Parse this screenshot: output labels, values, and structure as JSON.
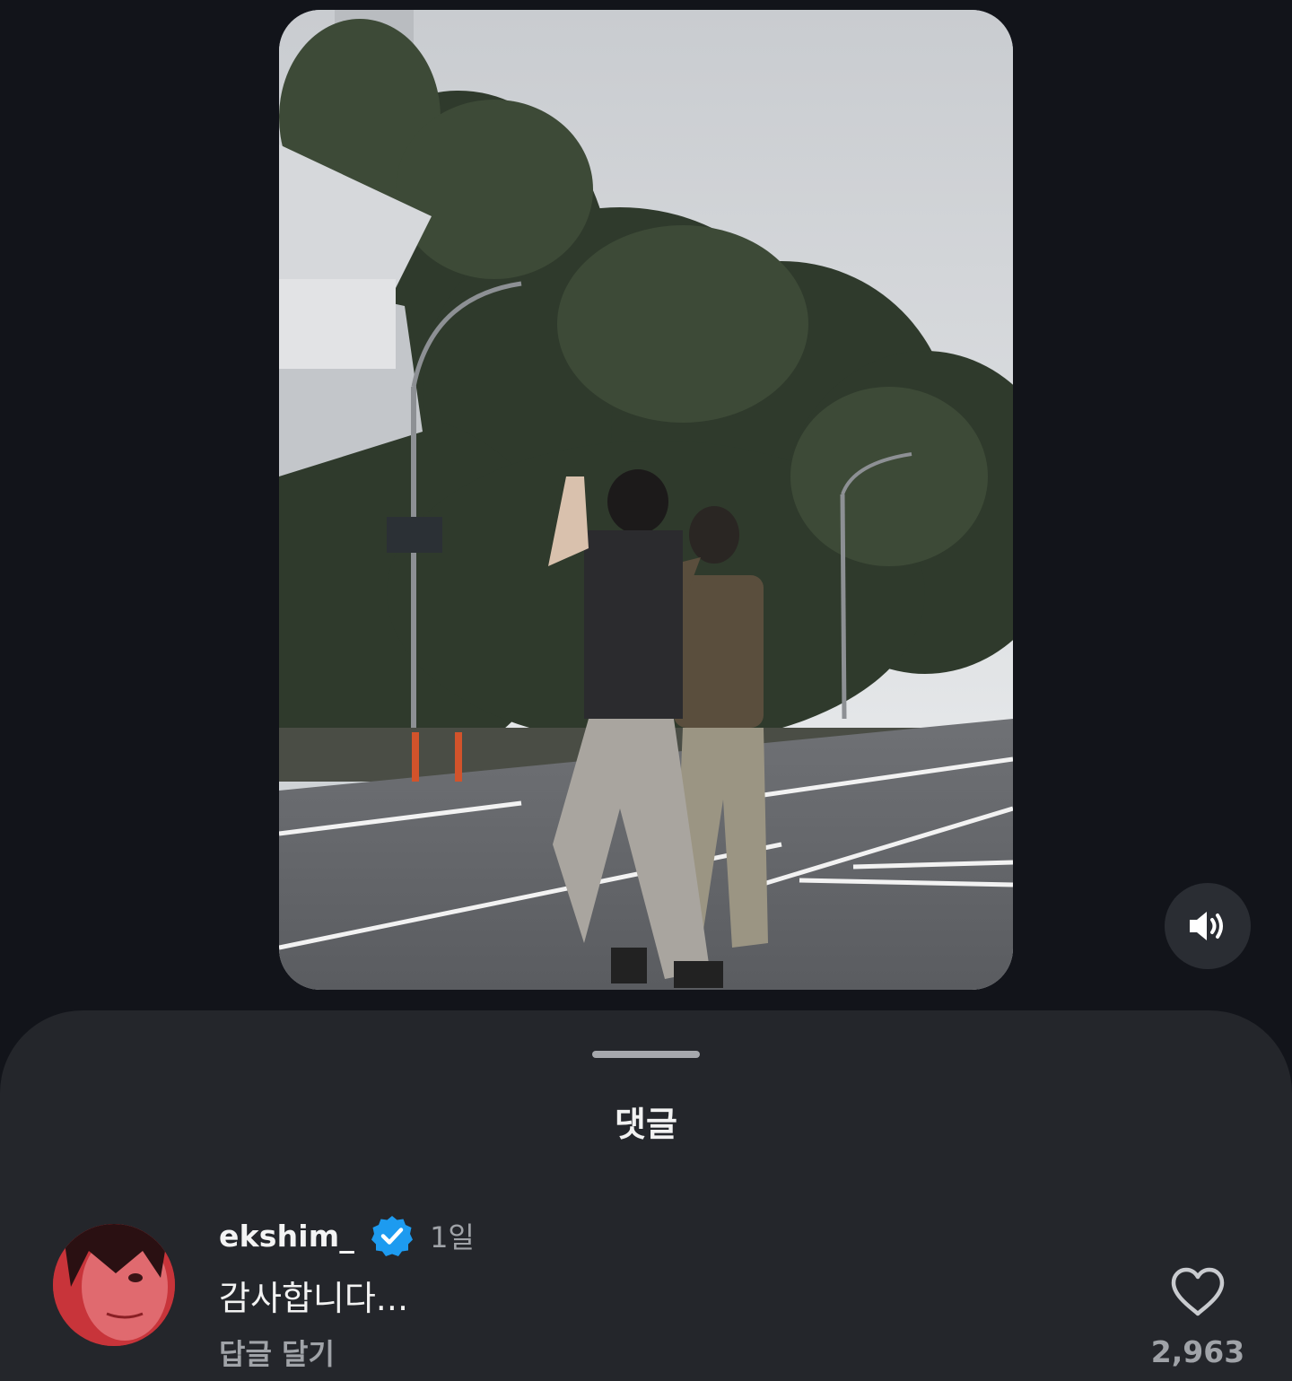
{
  "video": {
    "sound_icon": "speaker-volume-icon"
  },
  "comments_sheet": {
    "title": "댓글"
  },
  "comment": {
    "username": "ekshim_",
    "verified_icon": "verified-badge-icon",
    "time": "1일",
    "text": "감사합니다...",
    "reply_label": "답글 달기",
    "like_icon": "heart-outline-icon",
    "like_count": "2,963"
  },
  "colors": {
    "background": "#12141a",
    "sheet": "#24262b",
    "verified": "#1d9bf0",
    "muted_text": "#a0a3a8"
  }
}
